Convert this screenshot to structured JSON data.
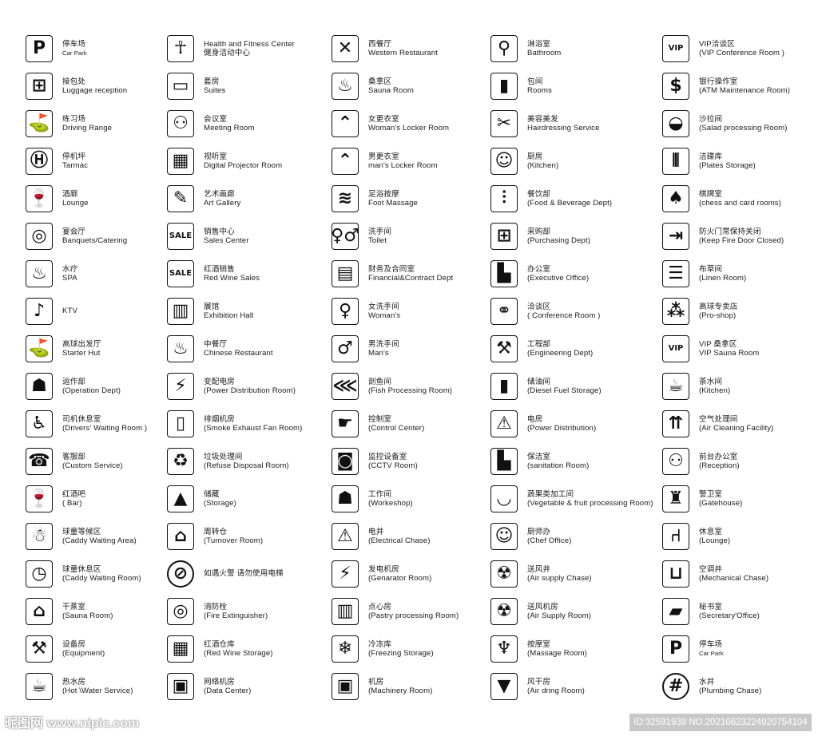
{
  "columns": [
    [
      {
        "icon": "parking-icon",
        "lines": [
          "停车场",
          "Car Park"
        ],
        "tiny": 1
      },
      {
        "icon": "luggage-icon",
        "lines": [
          "接包处",
          "Luggage reception"
        ]
      },
      {
        "icon": "golfer-icon",
        "lines": [
          "练习场",
          "Driving Range"
        ]
      },
      {
        "icon": "helipad-icon",
        "lines": [
          "停机坪",
          "Tarmac"
        ]
      },
      {
        "icon": "wine-bottle-glass-icon",
        "lines": [
          "酒廊",
          "Lounge"
        ]
      },
      {
        "icon": "plate-cutlery-icon",
        "lines": [
          "宴会厅",
          "Banquets/Catering"
        ]
      },
      {
        "icon": "bath-spa-icon",
        "lines": [
          "水疗",
          "SPA"
        ]
      },
      {
        "icon": "microphone-icon",
        "lines": [
          "KTV"
        ]
      },
      {
        "icon": "golfer-icon",
        "lines": [
          "高球出发厅",
          "Starter Hut"
        ]
      },
      {
        "icon": "operator-desk-icon",
        "lines": [
          "运作部",
          "(Operation Dept)"
        ]
      },
      {
        "icon": "seated-driver-icon",
        "lines": [
          "司机休息室",
          "(Drivers' Waiting Room )"
        ]
      },
      {
        "icon": "phone-person-icon",
        "lines": [
          "客服部",
          "(Custom Service)"
        ]
      },
      {
        "icon": "wine-bottle-glass-icon",
        "lines": [
          "红酒吧",
          "( Bar)"
        ]
      },
      {
        "icon": "caddy-icon",
        "lines": [
          "球童等候区",
          "(Caddy Waiting Area)"
        ]
      },
      {
        "icon": "caddy-clock-icon",
        "lines": [
          "球童休息区",
          "(Caddy Waiting Room)"
        ]
      },
      {
        "icon": "house-steam-icon",
        "lines": [
          "干蒸室",
          "(Sauna Room)"
        ]
      },
      {
        "icon": "wrench-icon",
        "lines": [
          "设备房",
          "(Equipment)"
        ]
      },
      {
        "icon": "kettle-icon",
        "lines": [
          "热水房",
          "(Hot \\Water Service)"
        ]
      }
    ],
    [
      {
        "icon": "fitness-person-icon",
        "lines": [
          "Health and Fitness Center",
          "健身活动中心"
        ]
      },
      {
        "icon": "bed-icon",
        "lines": [
          "套房",
          "Suites"
        ]
      },
      {
        "icon": "meeting-icon",
        "lines": [
          "会议室",
          "Meeting Room"
        ]
      },
      {
        "icon": "projector-screen-icon",
        "lines": [
          "视听室",
          "Digital Projector Room"
        ]
      },
      {
        "icon": "palette-icon",
        "lines": [
          "艺术画廊",
          "Art Gallery"
        ]
      },
      {
        "icon": "sale-person-icon",
        "lines": [
          "销售中心",
          "Sales Center"
        ]
      },
      {
        "icon": "sale-wine-icon",
        "lines": [
          "红酒销售",
          "Red Wine Sales"
        ]
      },
      {
        "icon": "exhibition-panels-icon",
        "lines": [
          "展馆",
          "Exhibition Hall"
        ]
      },
      {
        "icon": "hot-bowl-icon",
        "lines": [
          "中餐厅",
          "Chinese Restaurant"
        ]
      },
      {
        "icon": "lightning-icon",
        "lines": [
          "变配电房",
          "(Power Distribution Room)"
        ]
      },
      {
        "icon": "smoke-door-icon",
        "lines": [
          "排烟机房",
          "(Smoke Exhaust Fan Room)"
        ]
      },
      {
        "icon": "recycle-icon",
        "lines": [
          "垃圾处理间",
          "(Refuse Disposal Room)"
        ]
      },
      {
        "icon": "stacked-boxes-icon",
        "lines": [
          "储藏",
          "(Storage)"
        ]
      },
      {
        "icon": "warehouse-icon",
        "lines": [
          "周转仓",
          "(Turnover Room)"
        ]
      },
      {
        "icon": "no-elevator-fire-icon",
        "lines": [
          "如遇火警 请勿使用电梯"
        ]
      },
      {
        "icon": "fire-hose-icon",
        "lines": [
          "消防栓",
          "(Fire Extinguisher)"
        ]
      },
      {
        "icon": "wine-rack-icon",
        "lines": [
          "红酒仓库",
          "(Red Wine Storage)"
        ]
      },
      {
        "icon": "computer-icon",
        "lines": [
          "网络机房",
          "(Data Center)"
        ]
      }
    ],
    [
      {
        "icon": "knife-fork-icon",
        "lines": [
          "西餐厅",
          "Western  Restaurant"
        ]
      },
      {
        "icon": "sauna-tub-icon",
        "lines": [
          "桑拿区",
          "Sauna Room"
        ]
      },
      {
        "icon": "hanger-man-icon",
        "lines": [
          "女更衣室",
          "Woman's Locker Room"
        ]
      },
      {
        "icon": "hanger-woman-icon",
        "lines": [
          "男更衣室",
          "man's Locker Room"
        ]
      },
      {
        "icon": "footprints-icon",
        "lines": [
          "足浴按摩",
          "Foot Massage"
        ]
      },
      {
        "icon": "toilet-icon",
        "lines": [
          "洗手间",
          "Toilet"
        ]
      },
      {
        "icon": "document-desk-icon",
        "lines": [
          "财务及合同室",
          "Financial&Contract Dept"
        ]
      },
      {
        "icon": "woman-icon",
        "lines": [
          "女洗手间",
          "Woman's"
        ]
      },
      {
        "icon": "man-icon",
        "lines": [
          "男洗手间",
          "Man's"
        ]
      },
      {
        "icon": "fish-knife-icon",
        "lines": [
          "剖鱼间",
          "(Fish Processing Room)"
        ]
      },
      {
        "icon": "control-hand-icon",
        "lines": [
          "控制室",
          "(Control Center)"
        ]
      },
      {
        "icon": "cctv-camera-icon",
        "lines": [
          "监控设备室",
          "(CCTV Room)"
        ]
      },
      {
        "icon": "operator-desk-icon",
        "lines": [
          "工作间",
          "(Workeshop)"
        ]
      },
      {
        "icon": "high-voltage-icon",
        "lines": [
          "电井",
          "(Electrical Chase)"
        ]
      },
      {
        "icon": "lightning-icon",
        "lines": [
          "发电机房",
          "(Genarator Room)"
        ]
      },
      {
        "icon": "drink-burger-icon",
        "lines": [
          "点心房",
          "(Pastry processing Room)"
        ]
      },
      {
        "icon": "snowflake-icon",
        "lines": [
          "冷冻库",
          "(Freezing Storage)"
        ]
      },
      {
        "icon": "computer-icon",
        "lines": [
          "机房",
          "(Machinery Room)"
        ]
      }
    ],
    [
      {
        "icon": "shower-icon",
        "lines": [
          "淋浴室",
          "Bathroom"
        ]
      },
      {
        "icon": "door-icon",
        "lines": [
          "包间",
          "Rooms"
        ]
      },
      {
        "icon": "scissors-comb-icon",
        "lines": [
          "美容美发",
          "Hairdressing Service"
        ]
      },
      {
        "icon": "chef-icon",
        "lines": [
          "厨房",
          "(Kitchen)"
        ]
      },
      {
        "icon": "cutlery-icon",
        "lines": [
          "餐饮部",
          "(Food & Beverage Dept)"
        ]
      },
      {
        "icon": "shopping-cart-icon",
        "lines": [
          "采购部",
          "(Purchasing Dept)"
        ]
      },
      {
        "icon": "office-desk-icon",
        "lines": [
          "办公室",
          "(Executive Office)"
        ]
      },
      {
        "icon": "handshake-icon",
        "lines": [
          "洽谈区",
          "( Conference Room )"
        ]
      },
      {
        "icon": "pickaxe-icon",
        "lines": [
          "工程部",
          "(Engineering Dept)"
        ]
      },
      {
        "icon": "oil-barrel-icon",
        "lines": [
          "储油间",
          "(Diesel Fuel Storage)"
        ]
      },
      {
        "icon": "high-voltage-icon",
        "lines": [
          "电房",
          "(Power Distribution)"
        ]
      },
      {
        "icon": "bucket-broom-icon",
        "lines": [
          "保洁室",
          "(sanitation Room)"
        ]
      },
      {
        "icon": "fruit-plate-icon",
        "lines": [
          "蔬果类加工间",
          "(Vegetable & fruit processing Room)"
        ]
      },
      {
        "icon": "chef-icon",
        "lines": [
          "厨师办",
          "(Chef Office)"
        ]
      },
      {
        "icon": "fan-icon",
        "lines": [
          "送风井",
          "(Air supply Chase)"
        ]
      },
      {
        "icon": "fan-icon",
        "lines": [
          "送风机房",
          "(Air Supply Room)"
        ]
      },
      {
        "icon": "massage-icon",
        "lines": [
          "按摩室",
          "(Massage Room)"
        ]
      },
      {
        "icon": "shirt-drying-icon",
        "lines": [
          "风干房",
          "(Air dring Room)"
        ]
      }
    ],
    [
      {
        "icon": "vip-handshake-icon",
        "lines": [
          "VIP洽谈区",
          "(VIP Conference Room )"
        ]
      },
      {
        "icon": "money-coins-icon",
        "lines": [
          "银行操作室",
          "(ATM Maintenance Room)"
        ]
      },
      {
        "icon": "salad-bowl-icon",
        "lines": [
          "沙拉间",
          "(Salad processing  Room)"
        ]
      },
      {
        "icon": "plates-rack-icon",
        "lines": [
          "洁碟库",
          "(Plates Storage)"
        ]
      },
      {
        "icon": "chess-cards-icon",
        "lines": [
          "棋牌室",
          "(chess and card rooms)"
        ]
      },
      {
        "icon": "fire-door-exit-icon",
        "lines": [
          "防火门常保持关闭",
          "(Keep Fire Door Closed)"
        ]
      },
      {
        "icon": "linen-stack-icon",
        "lines": [
          "布草间",
          "(Linen Room)"
        ]
      },
      {
        "icon": "golf-balls-basket-icon",
        "lines": [
          "高球专卖店",
          "(Pro-shop)"
        ]
      },
      {
        "icon": "vip-sauna-icon",
        "lines": [
          "VIP 桑拿区",
          "VIP Sauna Room"
        ]
      },
      {
        "icon": "teapot-icon",
        "lines": [
          "茶水间",
          "(Kitchen)"
        ]
      },
      {
        "icon": "air-filter-icon",
        "lines": [
          "空气处理间",
          "(Air Cleaning Facility)"
        ]
      },
      {
        "icon": "reception-desk-icon",
        "lines": [
          "前台办公室",
          "(Reception)"
        ]
      },
      {
        "icon": "guard-icon",
        "lines": [
          "警卫室",
          "(Gatehouse)"
        ]
      },
      {
        "icon": "lounge-seats-icon",
        "lines": [
          "休息室",
          "(Lounge)"
        ]
      },
      {
        "icon": "shaft-icon",
        "lines": [
          "空调井",
          "(Mechanical Chase)"
        ]
      },
      {
        "icon": "secretary-files-icon",
        "lines": [
          "秘书室",
          "(Secretary'Office)"
        ]
      },
      {
        "icon": "vip-parking-icon",
        "lines": [
          "停车场",
          "Car Park"
        ],
        "tiny": 1
      },
      {
        "icon": "plumbing-grid-icon",
        "lines": [
          "水井",
          "(Plumbing Chase)"
        ]
      }
    ]
  ],
  "watermark": {
    "site": "昵图网 www.nipic.com",
    "id": "ID:32591939 NO:20210623224920754104"
  }
}
